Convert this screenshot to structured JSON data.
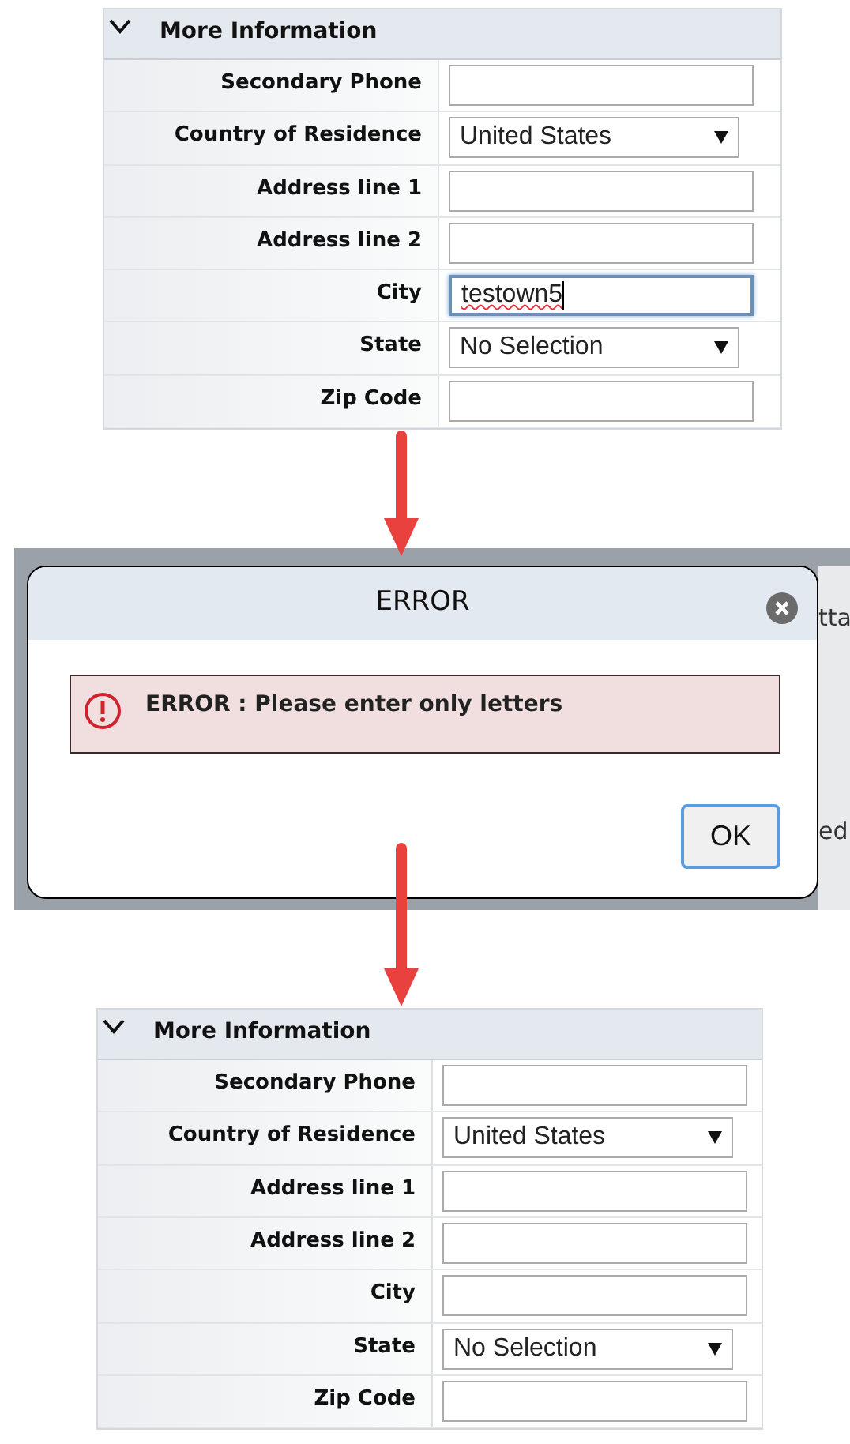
{
  "panels": [
    {
      "header": {
        "title": "More Information",
        "expanded": true
      },
      "fields": [
        {
          "label": "Secondary Phone",
          "kind": "text",
          "focused": false
        },
        {
          "label": "Country of Residence",
          "kind": "select",
          "value": "United States"
        },
        {
          "label": "Address line 1",
          "kind": "text",
          "focused": false
        },
        {
          "label": "Address line 2",
          "kind": "text",
          "focused": false
        },
        {
          "label": "City",
          "kind": "text",
          "value": "testown5",
          "focused": true
        },
        {
          "label": "State",
          "kind": "select",
          "value": "No Selection"
        },
        {
          "label": "Zip Code",
          "kind": "text",
          "focused": false
        }
      ]
    },
    {
      "header": {
        "title": "More Information",
        "expanded": true
      },
      "fields": [
        {
          "label": "Secondary Phone",
          "kind": "text",
          "focused": false
        },
        {
          "label": "Country of Residence",
          "kind": "select",
          "value": "United States"
        },
        {
          "label": "Address line 1",
          "kind": "text",
          "focused": false
        },
        {
          "label": "Address line 2",
          "kind": "text",
          "focused": false
        },
        {
          "label": "City",
          "kind": "text",
          "focused": false
        },
        {
          "label": "State",
          "kind": "select",
          "value": "No Selection"
        },
        {
          "label": "Zip Code",
          "kind": "text",
          "focused": false
        }
      ]
    }
  ],
  "dialog": {
    "title": "ERROR",
    "message": "ERROR : Please enter only letters",
    "button": "OK",
    "background_texts": [
      "tta",
      "ed"
    ]
  }
}
